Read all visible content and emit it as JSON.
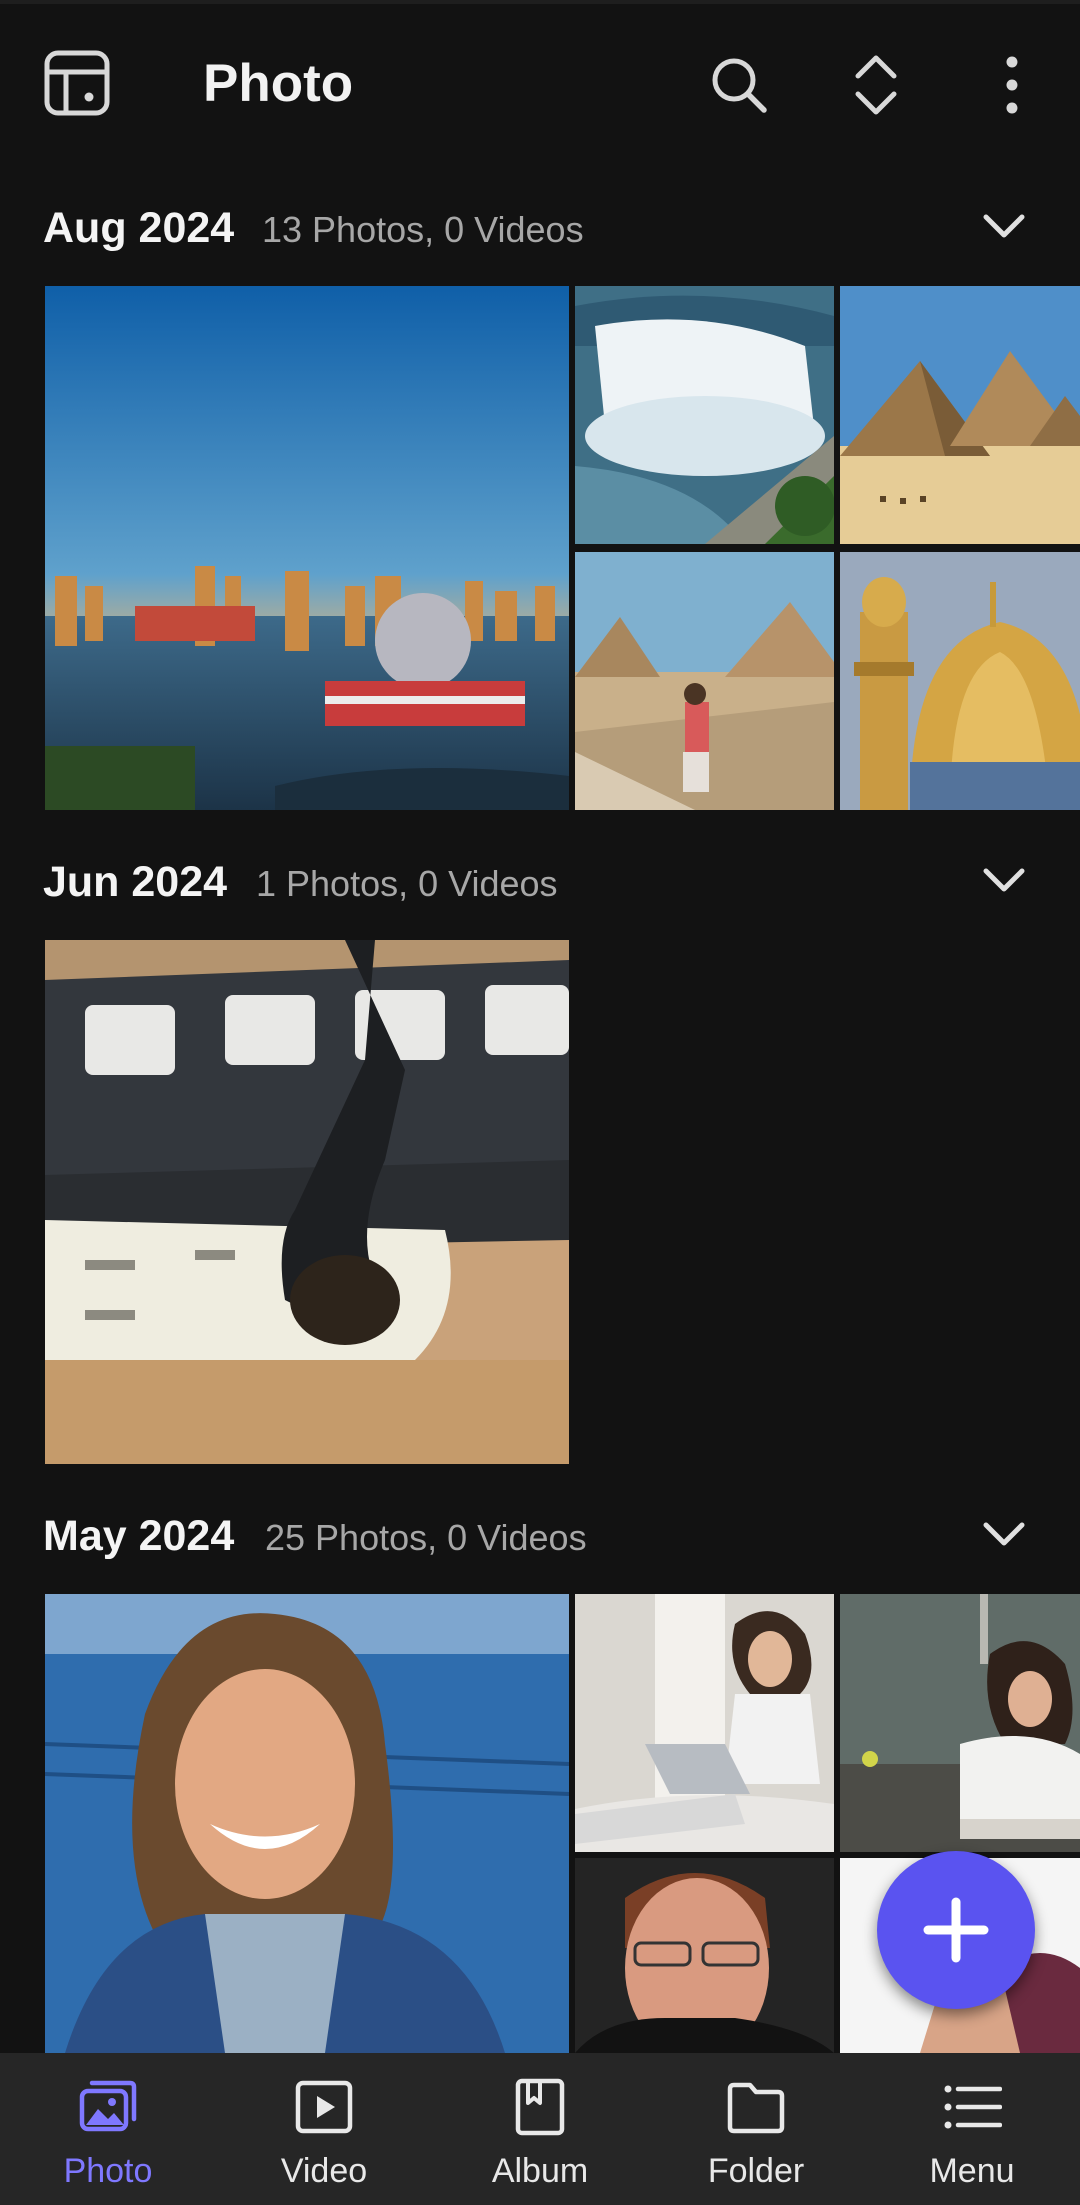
{
  "app_bar": {
    "title": "Photo",
    "icons": [
      "layout-icon",
      "search-icon",
      "sort-expand-icon",
      "more-vertical-icon"
    ]
  },
  "sections": [
    {
      "month": "Aug 2024",
      "counts": "13 Photos, 0 Videos"
    },
    {
      "month": "Jun 2024",
      "counts": "1 Photos, 0 Videos"
    },
    {
      "month": "May 2024",
      "counts": "25 Photos, 0 Videos"
    }
  ],
  "fab": {
    "icon": "plus-icon"
  },
  "bottom_nav": [
    {
      "label": "Photo",
      "icon": "photo-icon",
      "active": true
    },
    {
      "label": "Video",
      "icon": "video-icon",
      "active": false
    },
    {
      "label": "Album",
      "icon": "album-icon",
      "active": false
    },
    {
      "label": "Folder",
      "icon": "folder-icon",
      "active": false
    },
    {
      "label": "Menu",
      "icon": "menu-icon",
      "active": false
    }
  ],
  "colors": {
    "background": "#121212",
    "accent": "#5a53f0",
    "active_label": "#7f78ff",
    "nav_background": "#262626",
    "secondary_text": "#a7a7a7"
  }
}
